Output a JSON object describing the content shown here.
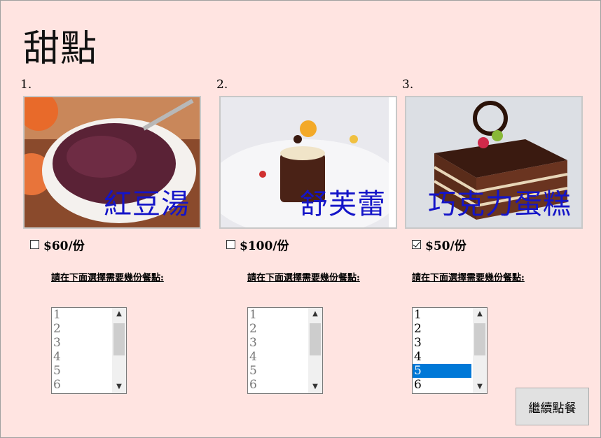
{
  "page": {
    "title": "甜點"
  },
  "items": [
    {
      "number": "1.",
      "name": "紅豆湯",
      "price": "$60/份",
      "checked": false,
      "instruction": "請在下面選擇需要幾份餐點:",
      "options": [
        "1",
        "2",
        "3",
        "4",
        "5",
        "6"
      ],
      "enabled": false,
      "selected": null
    },
    {
      "number": "2.",
      "name": "舒芙蕾",
      "price": "$100/份",
      "checked": false,
      "instruction": "請在下面選擇需要幾份餐點:",
      "options": [
        "1",
        "2",
        "3",
        "4",
        "5",
        "6"
      ],
      "enabled": false,
      "selected": null
    },
    {
      "number": "3.",
      "name": "巧克力蛋糕",
      "price": "$50/份",
      "checked": true,
      "instruction": "請在下面選擇需要幾份餐點:",
      "options": [
        "1",
        "2",
        "3",
        "4",
        "5",
        "6"
      ],
      "enabled": true,
      "selected": "5"
    }
  ],
  "actions": {
    "continue_label": "繼續點餐"
  },
  "colors": {
    "background": "#ffe4e1",
    "caption": "#1414c8",
    "selection": "#0078d7"
  }
}
